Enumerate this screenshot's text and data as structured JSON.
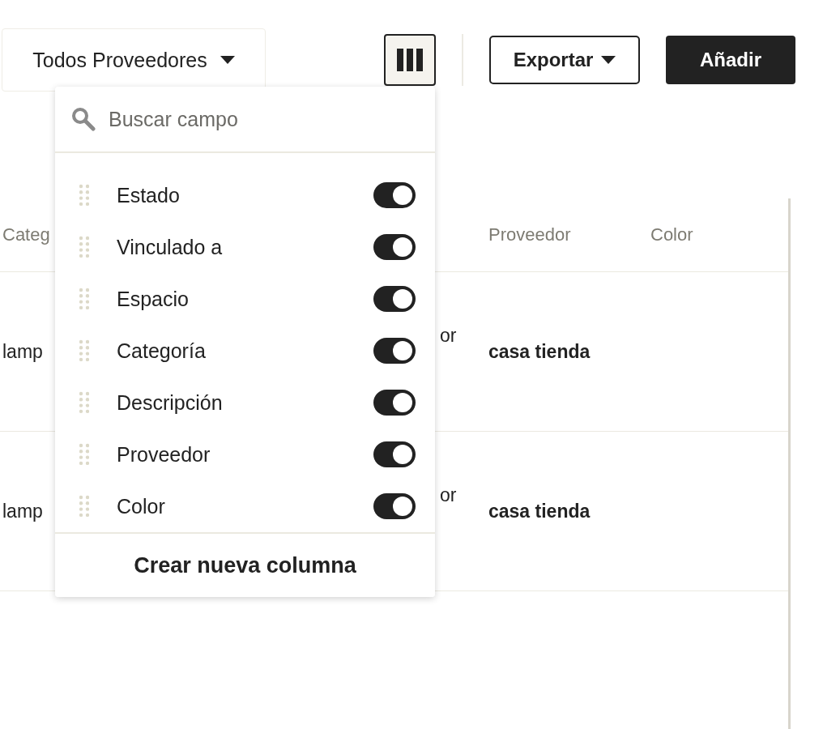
{
  "toolbar": {
    "filter": {
      "label": "Todos Proveedores"
    },
    "export": {
      "label": "Exportar"
    },
    "add": {
      "label": "Añadir"
    }
  },
  "table": {
    "columns": [
      "Categ",
      "",
      "Proveedor",
      "Color"
    ],
    "rows": [
      {
        "cells": [
          "lamp",
          "or",
          "casa tienda",
          ""
        ]
      },
      {
        "cells": [
          "lamp",
          "or",
          "casa tienda",
          ""
        ]
      }
    ]
  },
  "column_menu": {
    "search": {
      "placeholder": "Buscar campo"
    },
    "fields": [
      {
        "label": "Estado",
        "on": true
      },
      {
        "label": "Vinculado a",
        "on": true
      },
      {
        "label": "Espacio",
        "on": true
      },
      {
        "label": "Categoría",
        "on": true
      },
      {
        "label": "Descripción",
        "on": true
      },
      {
        "label": "Proveedor",
        "on": true
      },
      {
        "label": "Color",
        "on": true
      }
    ],
    "create": {
      "label": "Crear nueva columna"
    }
  }
}
